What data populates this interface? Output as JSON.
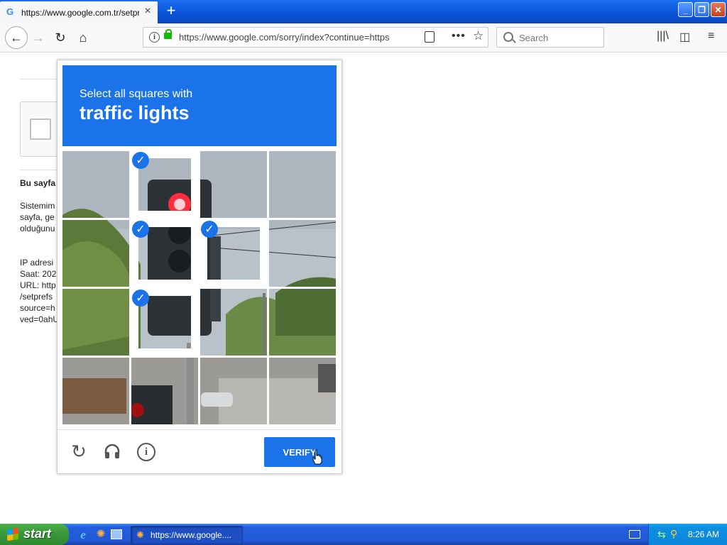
{
  "browser": {
    "tab_title": "https://www.google.com.tr/setprefs",
    "tab_favicon": "G",
    "address": "https://www.google.com/sorry/index?continue=https",
    "search_placeholder": "Search"
  },
  "page": {
    "heading_fragment": "Bu sayfa",
    "para_lines": [
      "Sistemim",
      "sayfa, ge",
      "olduğunu"
    ],
    "info_lines": [
      "IP adresi",
      "Saat: 202",
      "URL: http",
      "/setprefs",
      "source=h",
      "ved=0ahU"
    ]
  },
  "captcha": {
    "instruction_line1": "Select all squares with",
    "instruction_target": "traffic lights",
    "selected_tiles": [
      1,
      5,
      6,
      9
    ],
    "tile_count": 16,
    "verify_label": "VERIFY",
    "colors": {
      "accent": "#1a73e8"
    }
  },
  "taskbar": {
    "start_label": "start",
    "task_label": "https://www.google....",
    "clock": "8:26 AM"
  }
}
